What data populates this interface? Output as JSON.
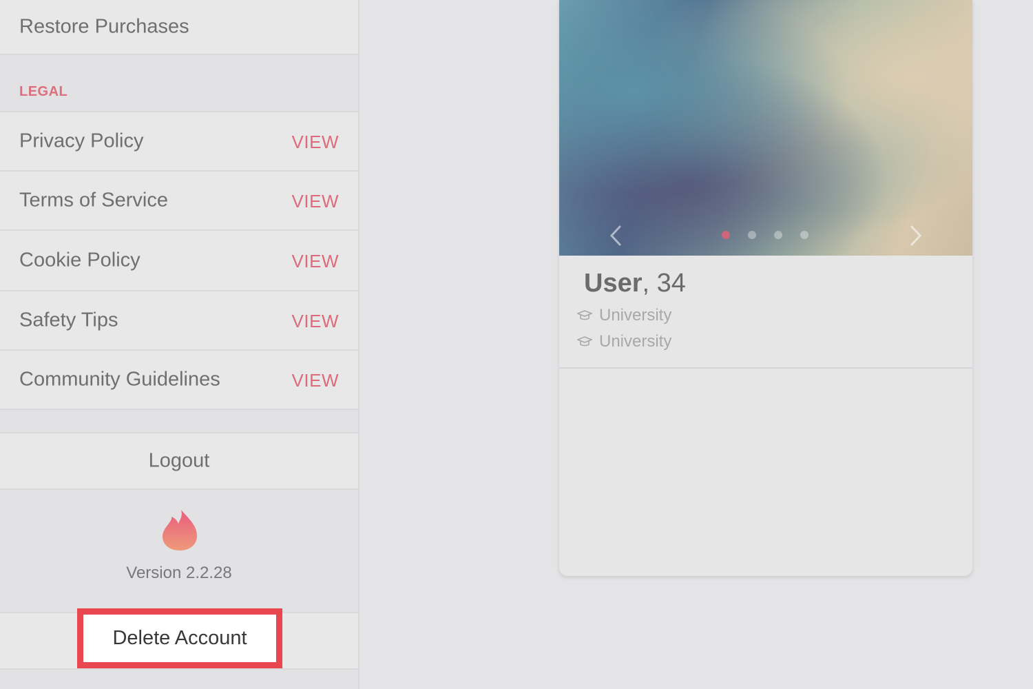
{
  "sidebar": {
    "restore_purchases": "Restore Purchases",
    "legal_header": "LEGAL",
    "legal_items": [
      {
        "label": "Privacy Policy",
        "action": "VIEW"
      },
      {
        "label": "Terms of Service",
        "action": "VIEW"
      },
      {
        "label": "Cookie Policy",
        "action": "VIEW"
      },
      {
        "label": "Safety Tips",
        "action": "VIEW"
      },
      {
        "label": "Community Guidelines",
        "action": "VIEW"
      }
    ],
    "logout": "Logout",
    "version": "Version 2.2.28",
    "delete_account": "Delete Account",
    "logo_icon": "flame-icon"
  },
  "card": {
    "name": "User",
    "age": ", 34",
    "education": [
      "University",
      "University"
    ],
    "photo_count": 4,
    "active_photo": 1,
    "accent_color": "#d0647a"
  },
  "colors": {
    "accent": "#dd6b7c",
    "highlight_border": "#e8474f"
  }
}
